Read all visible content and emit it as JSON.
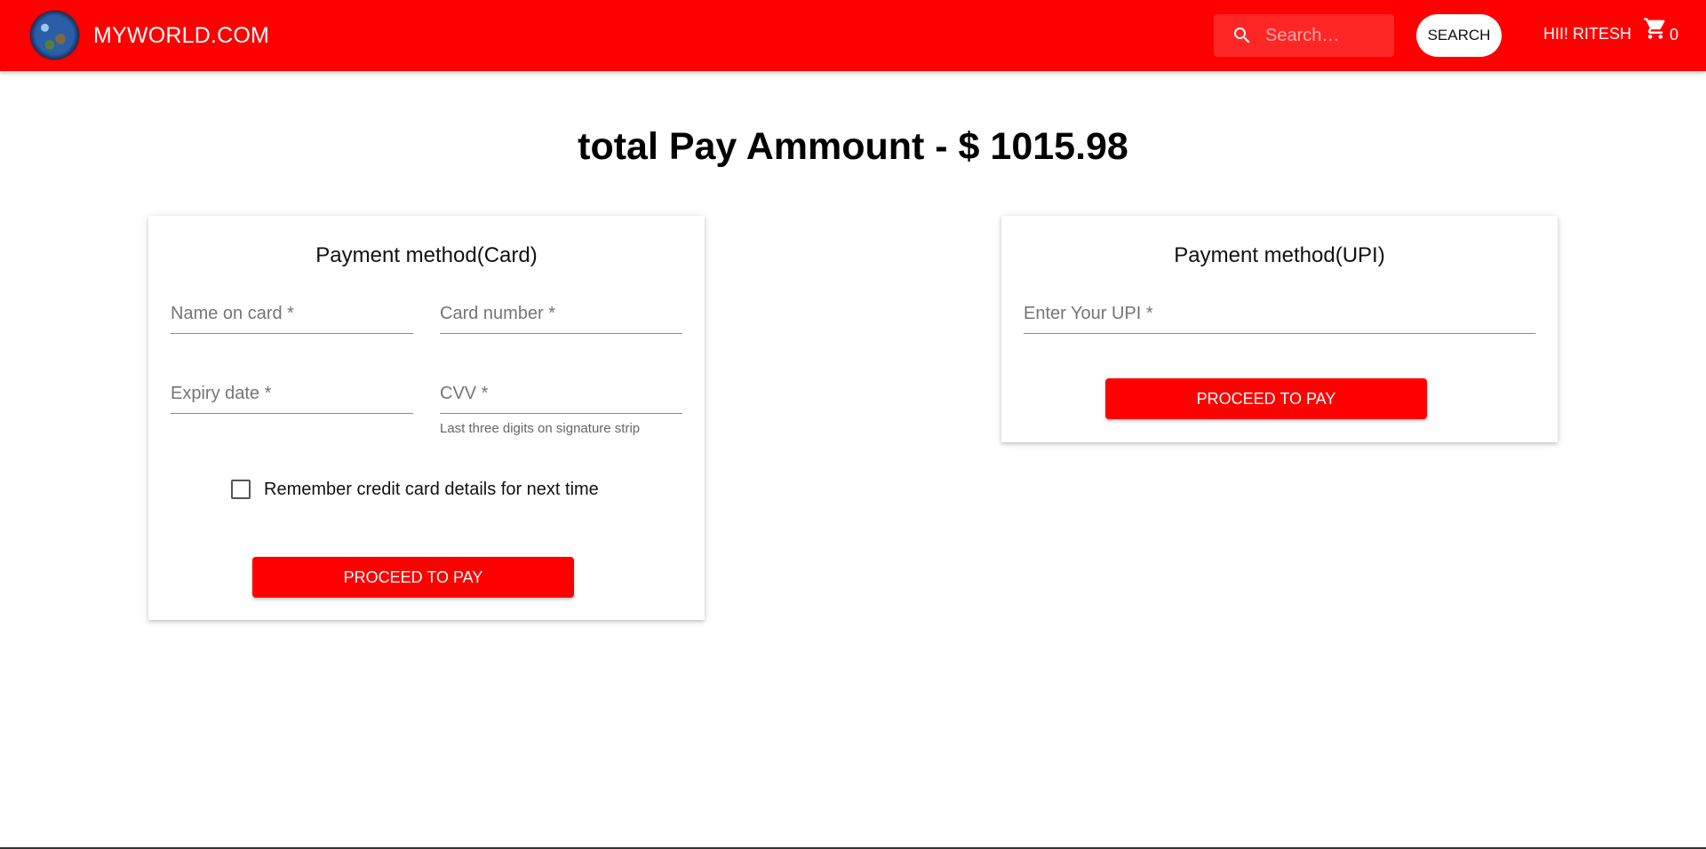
{
  "header": {
    "brand": "MYWORLD.COM",
    "search_placeholder": "Search…",
    "search_button": "SEARCH",
    "greeting": "HII! RITESH",
    "cart_count": "0"
  },
  "main": {
    "title": "total Pay Ammount - $ 1015.98"
  },
  "card_payment": {
    "title": "Payment method(Card)",
    "name_label": "Name on card *",
    "number_label": "Card number *",
    "expiry_label": "Expiry date *",
    "cvv_label": "CVV *",
    "cvv_helper": "Last three digits on signature strip",
    "remember_label": "Remember credit card details for next time",
    "remember_checked": false,
    "button": "PROCEED TO PAY"
  },
  "upi_payment": {
    "title": "Payment method(UPI)",
    "upi_label": "Enter Your UPI *",
    "button": "PROCEED TO PAY"
  },
  "colors": {
    "primary": "#ff0000",
    "background": "#ffffff"
  }
}
